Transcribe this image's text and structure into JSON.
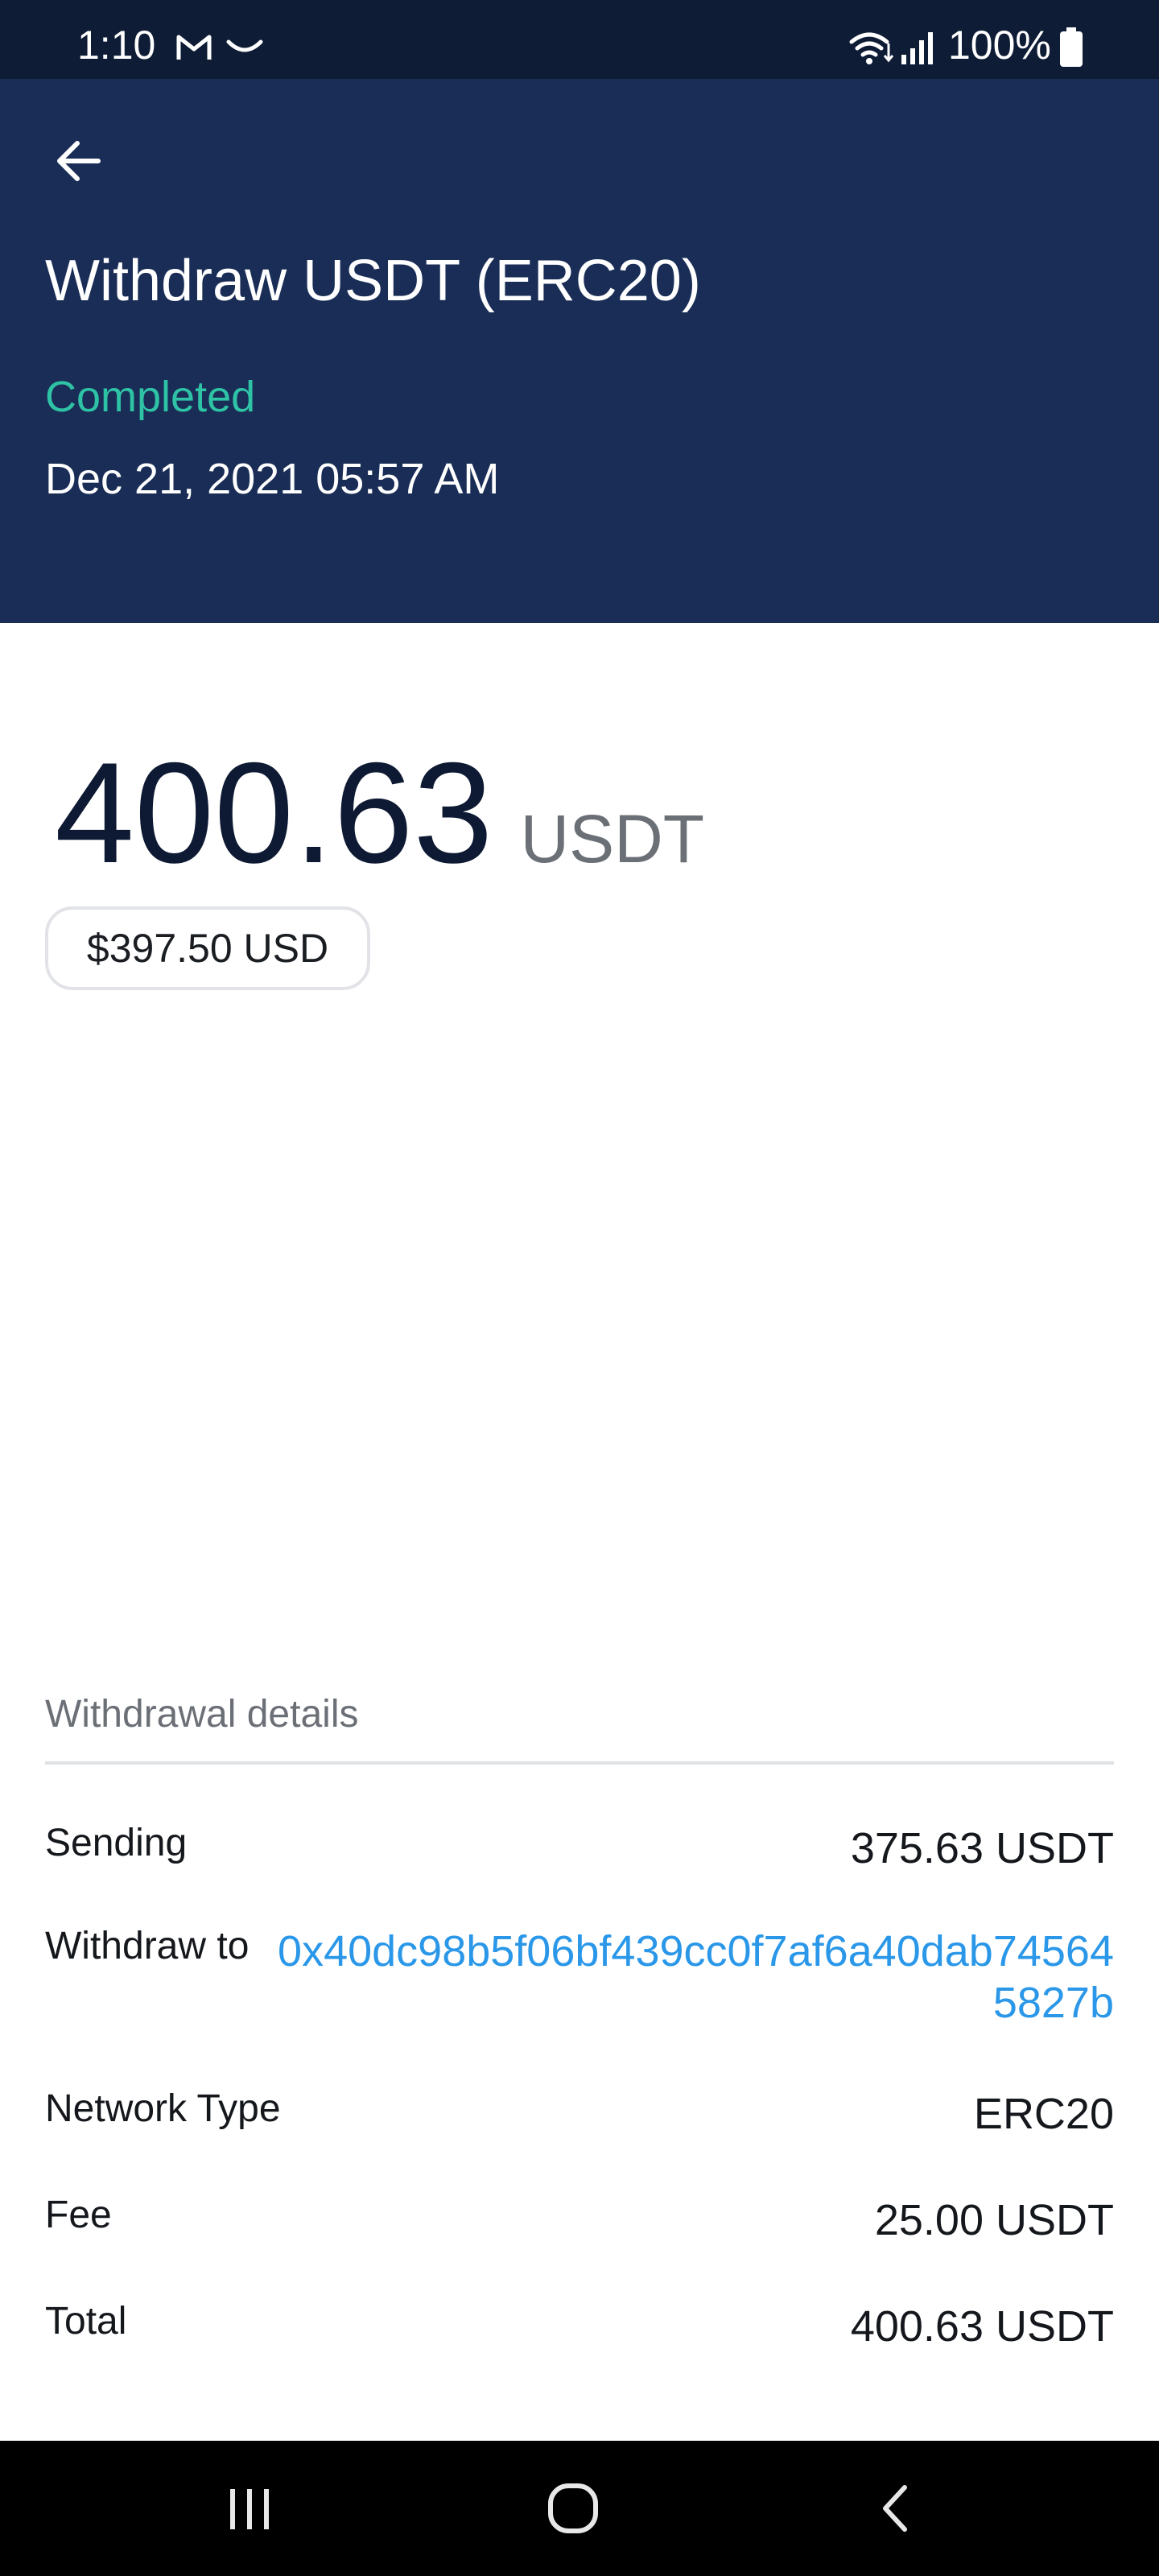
{
  "status_bar": {
    "time": "1:10",
    "battery_text": "100%",
    "icons": [
      "gmail-icon",
      "notification-arc-icon",
      "wifi-icon",
      "signal-icon",
      "battery-icon"
    ]
  },
  "header": {
    "back_icon": "arrow-left-icon",
    "title": "Withdraw USDT (ERC20)",
    "status": "Completed",
    "date": "Dec 21, 2021 05:57 AM",
    "colors": {
      "background": "#192d56",
      "status": "#2fc3a6"
    }
  },
  "amount": {
    "value": "400.63",
    "unit": "USDT",
    "usd_value": "$397.50 USD"
  },
  "details": {
    "heading": "Withdrawal details",
    "sending": {
      "label": "Sending",
      "value": "375.63 USDT"
    },
    "withdraw_to": {
      "label": "Withdraw to",
      "value": "0x40dc98b5f06bf439cc0f7af6a40dab745645827b",
      "color": "#2a97e8"
    },
    "network_type": {
      "label": "Network Type",
      "value": "ERC20"
    },
    "fee": {
      "label": "Fee",
      "value": "25.00 USDT"
    },
    "total": {
      "label": "Total",
      "value": "400.63 USDT"
    }
  },
  "nav_bar": {
    "icons": [
      "recent-apps-icon",
      "home-icon",
      "back-icon"
    ]
  }
}
